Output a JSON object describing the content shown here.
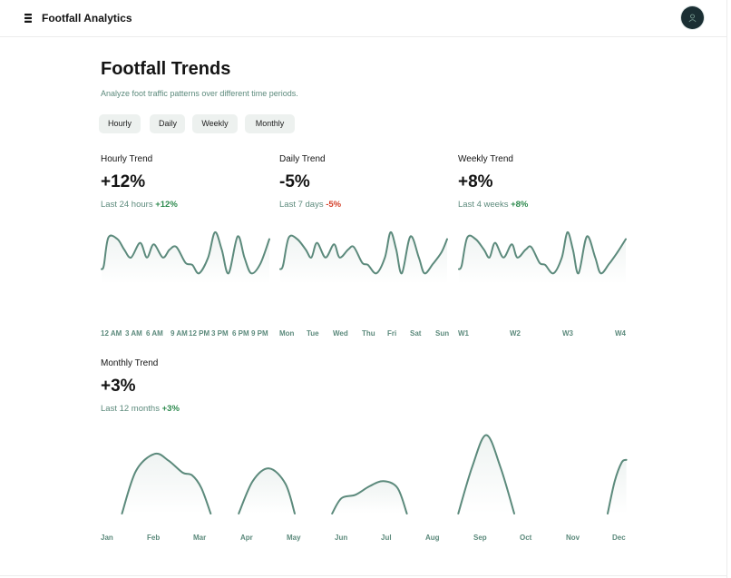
{
  "app": {
    "title": "Footfall Analytics",
    "logo_icon": "stack-icon",
    "avatar_icon": "user-avatar-icon"
  },
  "page": {
    "title": "Footfall Trends",
    "subtitle": "Analyze foot traffic patterns over different time periods."
  },
  "filters": [
    "Hourly",
    "Daily",
    "Weekly",
    "Monthly"
  ],
  "colors": {
    "line": "#5c8a7c",
    "label": "#5c8a7c",
    "positive": "#2d8a4e",
    "negative": "#d4412b",
    "button_bg": "#edf1ef",
    "avatar_bg": "#1a2e33"
  },
  "cards": {
    "hourly": {
      "title": "Hourly Trend",
      "value": "+12%",
      "period": "Last 24 hours",
      "delta": "+12%",
      "x_labels": [
        "12 AM",
        "3 AM",
        "6 AM",
        "9 AM",
        "12 PM",
        "3 PM",
        "6 PM",
        "9 PM"
      ]
    },
    "daily": {
      "title": "Daily Trend",
      "value": "-5%",
      "period": "Last 7 days",
      "delta": "-5%",
      "x_labels": [
        "Mon",
        "Tue",
        "Wed",
        "Thu",
        "Fri",
        "Sat",
        "Sun"
      ]
    },
    "weekly": {
      "title": "Weekly Trend",
      "value": "+8%",
      "period": "Last 4 weeks",
      "delta": "+8%",
      "x_labels": [
        "W1",
        "W2",
        "W3",
        "W4"
      ]
    },
    "monthly": {
      "title": "Monthly Trend",
      "value": "+3%",
      "period": "Last 12 months",
      "delta": "+3%",
      "x_labels": [
        "Jan",
        "Feb",
        "Mar",
        "Apr",
        "May",
        "Jun",
        "Jul",
        "Aug",
        "Sep",
        "Oct",
        "Nov",
        "Dec"
      ]
    }
  },
  "chart_data": [
    {
      "type": "area",
      "name": "hourly",
      "categories": [
        "12 AM",
        "3 AM",
        "6 AM",
        "9 AM",
        "12 PM",
        "3 PM",
        "6 PM",
        "9 PM"
      ],
      "ylim": [
        0,
        100
      ],
      "grid": false,
      "x": [
        0,
        0.1,
        0.3,
        0.7,
        1,
        1.3,
        1.7,
        2,
        2.3,
        2.7,
        3,
        3.3,
        3.7,
        4,
        4.3,
        4.7,
        5,
        5.3,
        5.6,
        6,
        6.3,
        6.6,
        7,
        7.4
      ],
      "y": [
        18,
        25,
        78,
        75,
        55,
        40,
        68,
        40,
        65,
        40,
        55,
        60,
        30,
        26,
        10,
        40,
        88,
        55,
        10,
        80,
        40,
        10,
        28,
        75
      ]
    },
    {
      "type": "area",
      "name": "daily",
      "categories": [
        "Mon",
        "Tue",
        "Wed",
        "Thu",
        "Fri",
        "Sat",
        "Sun"
      ],
      "ylim": [
        0,
        100
      ],
      "grid": false,
      "x": [
        0,
        0.1,
        0.3,
        0.6,
        0.9,
        1.1,
        1.3,
        1.6,
        1.9,
        2.1,
        2.4,
        2.6,
        2.9,
        3.1,
        3.4,
        3.7,
        3.9,
        4.1,
        4.3,
        4.6,
        4.9,
        5.1,
        5.4,
        5.7,
        5.9
      ],
      "y": [
        18,
        25,
        78,
        75,
        55,
        40,
        68,
        40,
        65,
        40,
        55,
        60,
        30,
        26,
        10,
        40,
        88,
        55,
        10,
        80,
        40,
        10,
        28,
        50,
        75
      ]
    },
    {
      "type": "area",
      "name": "weekly",
      "categories": [
        "W1",
        "W2",
        "W3",
        "W4"
      ],
      "ylim": [
        0,
        100
      ],
      "grid": false,
      "x": [
        1,
        1.05,
        1.15,
        1.3,
        1.45,
        1.55,
        1.65,
        1.8,
        1.95,
        2.05,
        2.2,
        2.3,
        2.45,
        2.55,
        2.7,
        2.85,
        2.95,
        3.05,
        3.15,
        3.3,
        3.45,
        3.55,
        3.7,
        3.85,
        4
      ],
      "y": [
        18,
        25,
        78,
        75,
        55,
        40,
        68,
        40,
        65,
        40,
        55,
        60,
        30,
        26,
        10,
        40,
        88,
        55,
        10,
        80,
        40,
        10,
        28,
        50,
        75
      ]
    },
    {
      "type": "area",
      "name": "monthly",
      "categories": [
        "Jan",
        "Feb",
        "Mar",
        "Apr",
        "May",
        "Jun",
        "Jul",
        "Aug",
        "Sep",
        "Oct",
        "Nov",
        "Dec"
      ],
      "ylim": [
        0,
        100
      ],
      "grid": false,
      "segments": [
        {
          "x": [
            1.3,
            1.6,
            2.0,
            2.3,
            2.6,
            2.8,
            3.0,
            3.2
          ],
          "y": [
            0,
            50,
            70,
            62,
            48,
            45,
            30,
            0
          ]
        },
        {
          "x": [
            3.8,
            4.1,
            4.45,
            4.8,
            5.0
          ],
          "y": [
            0,
            38,
            53,
            35,
            0
          ]
        },
        {
          "x": [
            5.8,
            6.0,
            6.3,
            6.6,
            6.9,
            7.2,
            7.4
          ],
          "y": [
            0,
            18,
            22,
            32,
            38,
            30,
            0
          ]
        },
        {
          "x": [
            8.5,
            8.8,
            9.1,
            9.4,
            9.7
          ],
          "y": [
            0,
            55,
            92,
            55,
            0
          ]
        },
        {
          "x": [
            11.7,
            11.85,
            12.0,
            12.1
          ],
          "y": [
            0,
            38,
            60,
            63
          ]
        }
      ]
    }
  ]
}
